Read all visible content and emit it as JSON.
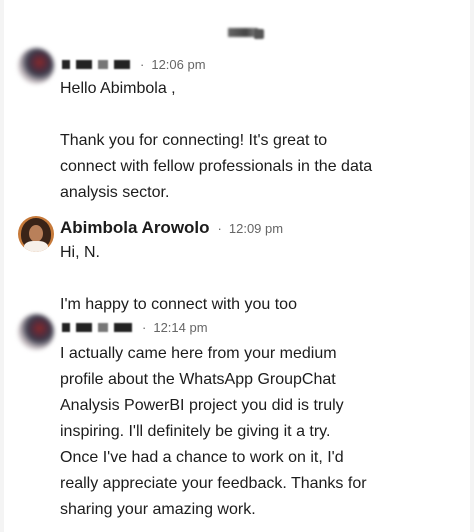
{
  "conversation": {
    "messages": [
      {
        "sender": "",
        "time": "12:06 pm",
        "lines": [
          "Hello Abimbola ,",
          "",
          "Thank you for connecting! It's great to",
          "connect with fellow professionals in the data",
          "analysis sector."
        ]
      },
      {
        "sender": "Abimbola Arowolo",
        "time": "12:09 pm",
        "lines": [
          "Hi, N.",
          "",
          "I'm happy to connect with you too"
        ]
      },
      {
        "sender": "",
        "time": "12:14 pm",
        "lines": [
          "I actually came here from your medium",
          "profile about the WhatsApp GroupChat",
          "Analysis PowerBI project you did is truly",
          "inspiring. I'll definitely be giving it a try.",
          "Once I've had a chance to work on it, I'd",
          "really appreciate your feedback. Thanks for",
          "sharing your amazing work."
        ]
      }
    ]
  },
  "separator": "·"
}
